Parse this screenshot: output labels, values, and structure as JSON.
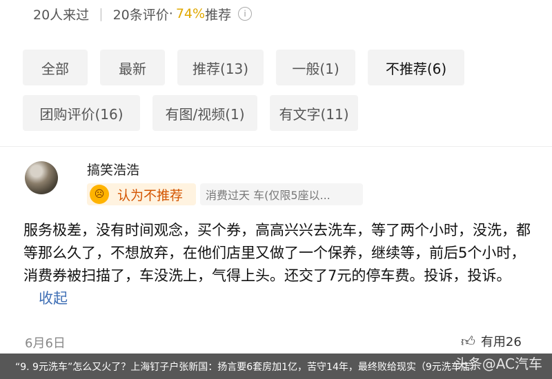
{
  "stats": {
    "visitors": "20人来过",
    "reviews": "20条评价",
    "dot": "·",
    "recommend_pct": "74%",
    "recommend_suffix": "推荐",
    "info_icon": "info-icon"
  },
  "filters": [
    {
      "label": "全部"
    },
    {
      "label": "最新"
    },
    {
      "label": "推荐(13)"
    },
    {
      "label": "一般(1)"
    },
    {
      "label": "不推荐(6)"
    },
    {
      "label": "团购评价(16)"
    },
    {
      "label": "有图/视频(1)"
    },
    {
      "label": "有文字(11)"
    }
  ],
  "review": {
    "username": "搞笑浩浩",
    "verdict_icon": "angry-face-icon",
    "verdict_label": "认为不推荐",
    "coupon": "消费过天      车(仅限5座以...",
    "text": "服务极差，没有时间观念，买个券，高高兴兴去洗车，等了两个小时，没洗，都等那么久了，不想放弃，在他们店里又做了一个保养，继续等，前后5个小时，消费券被扫描了，车没洗上，气得上头。还交了7元的停车费。投诉，投诉。",
    "collapse_label": "收起",
    "date": "6月6日",
    "like_label": "有用26"
  },
  "caption": "“9. 9元洗车”怎么又火了？上海钉子户张新国：扬言要6套房加1亿，苦守14年，最终败给现实（9元洗车店）",
  "watermark": "头条@AC汽车"
}
